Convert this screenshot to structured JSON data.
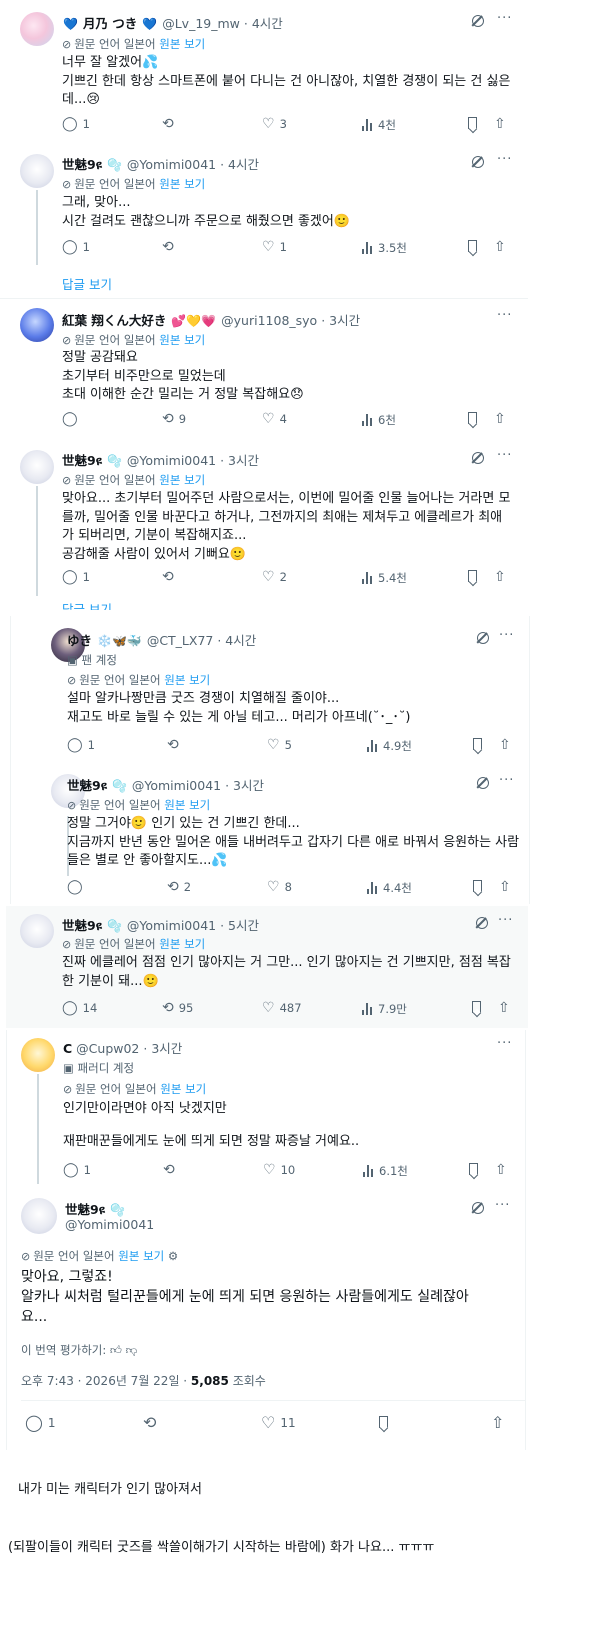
{
  "tweets": {
    "t1": {
      "name": "月乃 つき",
      "name_emoji_l": "💙",
      "name_emoji_r": "💙",
      "handle": "@Lv_19_mw",
      "time": "· 4시간",
      "lines": [
        "너무 잘 알겠어💦",
        "기쁘긴 한데 항상 스마트폰에 붙어 다니는 건 아니잖아, 치열한 경쟁이 되는 건 싫은",
        "데...😢"
      ],
      "replies": "1",
      "retweets": "",
      "likes": "3",
      "views": "4천"
    },
    "t2": {
      "name": "世魅9ዩ",
      "name_emoji_r": "🫧",
      "handle": "@Yomimi0041",
      "time": "· 4시간",
      "lines": [
        "그래, 맞아...",
        "시간 걸려도 괜찮으니까 주문으로 해줬으면 좋겠어🙂"
      ],
      "replies": "1",
      "retweets": "",
      "likes": "1",
      "views": "3.5천"
    },
    "show_replies_1": "답글 보기",
    "t3": {
      "name": "紅葉 翔くん大好き",
      "name_emoji_r": "💕💛💗",
      "handle": "@yuri1108_syo",
      "time": "· 3시간",
      "lines": [
        "정말 공감돼요",
        "초기부터 비주만으로 밀었는데",
        "초대 이해한 순간 밀리는 거 정말 복잡해요😞"
      ],
      "replies": "",
      "retweets": "9",
      "likes": "4",
      "views": "6천"
    },
    "t4": {
      "name": "世魅9ዩ",
      "name_emoji_r": "🫧",
      "handle": "@Yomimi0041",
      "time": "· 3시간",
      "lines": [
        "맞아요... 초기부터 밀어주던 사람으로서는, 이번에 밀어줄 인물 늘어나는 거라면 모",
        "를까, 밀어줄 인물 바꾼다고 하거나, 그전까지의 최애는 제쳐두고 에클레르가 최애",
        "가 되버리면, 기분이 복잡해지죠...",
        "공감해줄 사람이 있어서 기뻐요🙂"
      ],
      "replies": "1",
      "retweets": "",
      "likes": "2",
      "views": "5.4천"
    },
    "show_replies_2": "답글 보기",
    "t5": {
      "name": "ゆき",
      "name_emoji_r": "❄️🦋🐳",
      "handle": "@CT_LX77",
      "time": "· 4시간",
      "badge": "팬 계정",
      "lines": [
        "설마 알카나짱만큼 굿즈 경쟁이 치열해질 줄이야...",
        "재고도 바로 늘릴 수 있는 게 아닐 테고... 머리가 아프네(˘･_･˘)"
      ],
      "replies": "1",
      "retweets": "",
      "likes": "5",
      "views": "4.9천"
    },
    "t6": {
      "name": "世魅9ዩ",
      "name_emoji_r": "🫧",
      "handle": "@Yomimi0041",
      "time": "· 3시간",
      "lines": [
        "정말 그거야🙂 인기 있는 건 기쁘긴 한데...",
        "지금까지 반년 동안 밀어온 애들 내버려두고 갑자기 다른 애로 바꿔서 응원하는 사람",
        "들은 별로 안 좋아할지도...💦"
      ],
      "replies": "",
      "retweets": "2",
      "likes": "8",
      "views": "4.4천"
    },
    "t7": {
      "name": "世魅9ዩ",
      "name_emoji_r": "🫧",
      "handle": "@Yomimi0041",
      "time": "· 5시간",
      "lines": [
        "진짜 에클레어 점점 인기 많아지는 거 그만... 인기 많아지는 건 기쁘지만, 점점 복잡",
        "한 기분이 돼...🙂"
      ],
      "replies": "14",
      "retweets": "95",
      "likes": "487",
      "views": "7.9만"
    },
    "t8": {
      "name": "C",
      "name_emoji_r": "",
      "handle": "@Cupw02",
      "time": "· 3시간",
      "badge": "패러디 계정",
      "lines": [
        "인기만이라면야 아직 낫겠지만",
        "",
        "재판매꾼들에게도 눈에 띄게 되면 정말 짜증날 거예요.."
      ],
      "replies": "1",
      "retweets": "",
      "likes": "10",
      "views": "6.1천"
    },
    "t9": {
      "name": "世魅9ዩ",
      "name_emoji_r": "🫧",
      "handle": "@Yomimi0041",
      "lines": [
        "맞아요, 그렇죠!",
        "알카나 씨처럼 털리꾼들에게 눈에 띄게 되면 응원하는 사람들에게도 실례잖아",
        "요..."
      ],
      "rate": "이 번역 평가하기:",
      "meta_time": "오후 7:43 · 2026년 7월 22일 · ",
      "meta_views": "5,085",
      "meta_views_label": " 조회수",
      "replies": "1",
      "retweets": "",
      "likes": "11",
      "views": ""
    }
  },
  "translate": {
    "prefix": "원문 언어 일본어",
    "link": "원본 보기"
  },
  "captions": {
    "c1": "내가 미는 캐릭터가 인기 많아져서",
    "c2": "(되팔이들이 캐릭터 굿즈를 싹쓸이해가기 시작하는 바람에) 화가 나요... ㅠㅠㅠ"
  }
}
